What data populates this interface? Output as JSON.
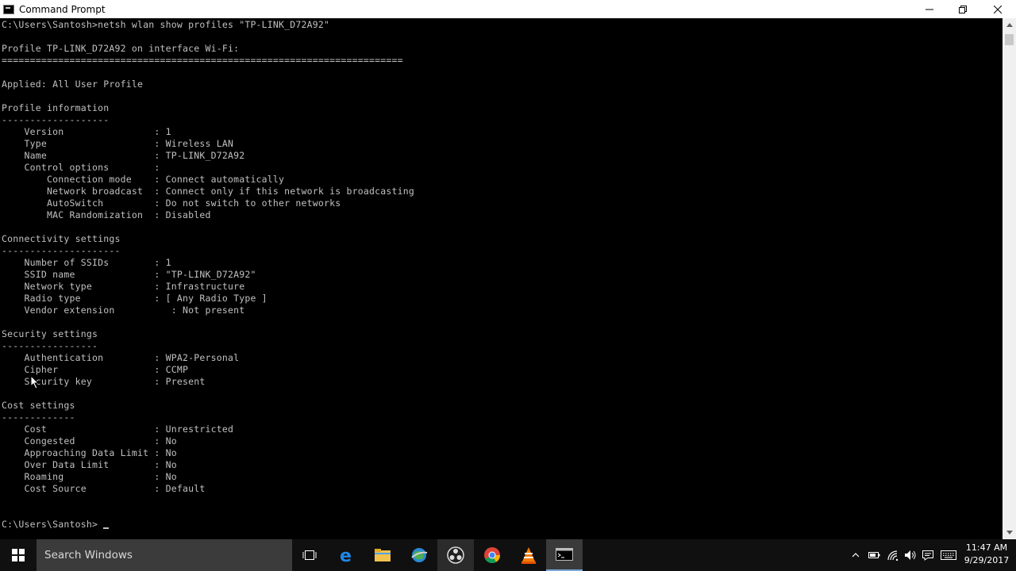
{
  "window": {
    "title": "Command Prompt"
  },
  "console": {
    "lines": [
      "C:\\Users\\Santosh>netsh wlan show profiles \"TP-LINK_D72A92\"",
      "Profile TP-LINK_D72A92 on interface Wi-Fi:",
      "=======================================================================",
      "Applied: All User Profile",
      "Profile information",
      "-------------------",
      "    Version                : 1",
      "    Type                   : Wireless LAN",
      "    Name                   : TP-LINK_D72A92",
      "    Control options        :",
      "        Connection mode    : Connect automatically",
      "        Network broadcast  : Connect only if this network is broadcasting",
      "        AutoSwitch         : Do not switch to other networks",
      "        MAC Randomization  : Disabled",
      "Connectivity settings",
      "---------------------",
      "    Number of SSIDs        : 1",
      "    SSID name              : \"TP-LINK_D72A92\"",
      "    Network type           : Infrastructure",
      "    Radio type             : [ Any Radio Type ]",
      "    Vendor extension          : Not present",
      "Security settings",
      "-----------------",
      "    Authentication         : WPA2-Personal",
      "    Cipher                 : CCMP",
      "    Security key           : Present",
      "Cost settings",
      "-------------",
      "    Cost                   : Unrestricted",
      "    Congested              : No",
      "    Approaching Data Limit : No",
      "    Over Data Limit        : No",
      "    Roaming                : No",
      "    Cost Source            : Default",
      "C:\\Users\\Santosh>"
    ]
  },
  "taskbar": {
    "search_placeholder": "Search Windows",
    "time": "11:47 AM",
    "date": "9/29/2017",
    "pinned_icons": [
      "task-view-icon",
      "edge-icon",
      "file-explorer-icon",
      "globe-app-icon",
      "obs-icon",
      "chrome-icon",
      "vlc-icon",
      "command-prompt-icon"
    ],
    "tray_icons": [
      "show-hidden-icons-icon",
      "battery-icon",
      "wifi-icon",
      "volume-icon",
      "action-center-icon",
      "keyboard-icon"
    ]
  }
}
